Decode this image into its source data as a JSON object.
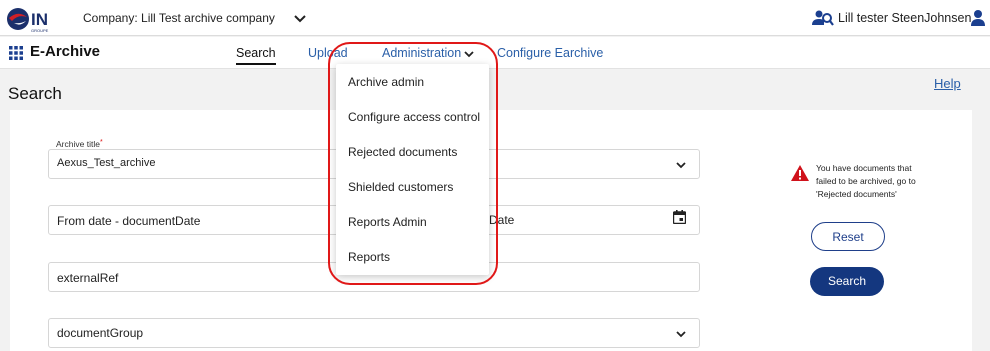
{
  "header": {
    "company_label": "Company: Lill Test archive company",
    "user_name": "Lill tester SteenJohnsen",
    "brand_colors": {
      "logo_red": "#d21f26",
      "logo_navy": "#1b2f6b"
    }
  },
  "nav": {
    "app_title": "E-Archive",
    "tabs": [
      {
        "label": "Search",
        "active": true
      },
      {
        "label": "Upload"
      },
      {
        "label": "Administration"
      },
      {
        "label": "Configure Earchive"
      }
    ]
  },
  "admin_menu": {
    "items": [
      "Archive admin",
      "Configure access control",
      "Rejected documents",
      "Shielded customers",
      "Reports Admin",
      "Reports"
    ]
  },
  "page": {
    "title": "Search",
    "help_link": "Help"
  },
  "form": {
    "archive_title_label": "Archive title",
    "required_mark": "*",
    "archive_title_value": "Aexus_Test_archive",
    "from_date_placeholder": "From date - documentDate",
    "to_date_fragment": "Date",
    "external_ref_placeholder": "externalRef",
    "document_group_placeholder": "documentGroup"
  },
  "warning": {
    "text": "You have documents that failed to be archived, go to 'Rejected documents'",
    "color": "#d0121b"
  },
  "actions": {
    "reset_label": "Reset",
    "search_label": "Search",
    "primary_color": "#14377f"
  }
}
